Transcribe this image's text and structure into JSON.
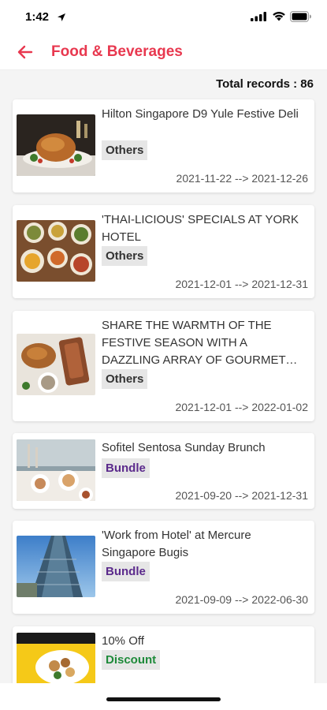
{
  "status_bar": {
    "time": "1:42"
  },
  "header": {
    "title": "Food & Beverages"
  },
  "total_records": "Total records : 86",
  "items": [
    {
      "title": "Hilton Singapore D9 Yule Festive Deli",
      "tag": "Others",
      "dates": "2021-11-22 --> 2021-12-26"
    },
    {
      "title": "'THAI-LICIOUS' SPECIALS AT YORK HOTEL",
      "tag": "Others",
      "dates": "2021-12-01 --> 2021-12-31"
    },
    {
      "title": " SHARE THE WARMTH OF THE FESTIVE SEASON WITH A DAZZLING ARRAY OF GOURMET DELIGHTS",
      "tag": "Others",
      "dates": "2021-12-01 --> 2022-01-02"
    },
    {
      "title": "Sofitel Sentosa Sunday Brunch",
      "tag": "Bundle",
      "dates": "2021-09-20 --> 2021-12-31"
    },
    {
      "title": "'Work from Hotel' at Mercure Singapore Bugis",
      "tag": "Bundle",
      "dates": "2021-09-09 --> 2022-06-30"
    },
    {
      "title": "10% Off",
      "tag": "Discount",
      "dates": ""
    }
  ],
  "colors": {
    "accent": "#e8384f",
    "bundle": "#5b2a8c",
    "discount": "#1e8a3a"
  }
}
